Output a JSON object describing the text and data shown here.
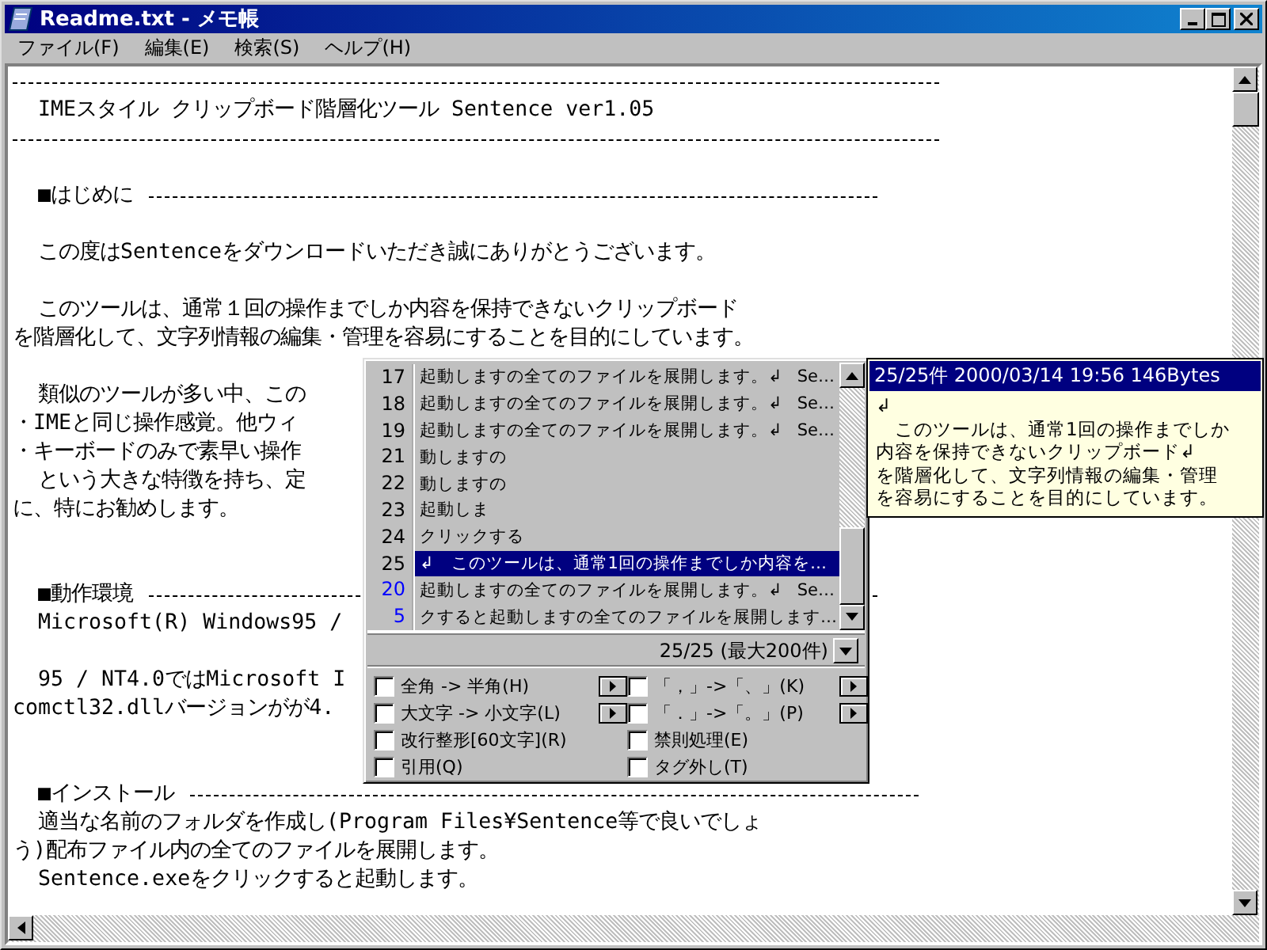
{
  "window": {
    "title": "Readme.txt - メモ帳"
  },
  "menu": [
    "ファイル(F)",
    "編集(E)",
    "検索(S)",
    "ヘルプ(H)"
  ],
  "document": [
    {
      "kind": "rule"
    },
    {
      "kind": "text",
      "text": "  IMEスタイル クリップボード階層化ツール Sentence ver1.05"
    },
    {
      "kind": "rule"
    },
    {
      "kind": "blank"
    },
    {
      "kind": "heading",
      "text": "  ■はじめに"
    },
    {
      "kind": "blank"
    },
    {
      "kind": "text",
      "text": "  この度はSentenceをダウンロードいただき誠にありがとうございます。"
    },
    {
      "kind": "blank"
    },
    {
      "kind": "text",
      "text": "  このツールは、通常１回の操作までしか内容を保持できないクリップボード"
    },
    {
      "kind": "text",
      "text": "を階層化して、文字列情報の編集・管理を容易にすることを目的にしています。"
    },
    {
      "kind": "blank"
    },
    {
      "kind": "text",
      "text": "  類似のツールが多い中、この"
    },
    {
      "kind": "text",
      "text": "・IMEと同じ操作感覚。他ウィ"
    },
    {
      "kind": "text",
      "text": "・キーボードのみで素早い操作"
    },
    {
      "kind": "text",
      "text": "  という大きな特徴を持ち、定"
    },
    {
      "kind": "text",
      "text": "に、特にお勧めします。"
    },
    {
      "kind": "blank"
    },
    {
      "kind": "blank"
    },
    {
      "kind": "heading",
      "text": "  ■動作環境"
    },
    {
      "kind": "text",
      "text": "  Microsoft(R) Windows95 / "
    },
    {
      "kind": "blank"
    },
    {
      "kind": "text",
      "text": "  95 / NT4.0ではMicrosoft I"
    },
    {
      "kind": "text",
      "text": "comctl32.dllバージョンがが4."
    },
    {
      "kind": "blank"
    },
    {
      "kind": "blank"
    },
    {
      "kind": "heading",
      "text": "  ■インストール"
    },
    {
      "kind": "text",
      "text": "  適当な名前のフォルダを作成し(Program Files¥Sentence等で良いでしょ"
    },
    {
      "kind": "text",
      "text": "う)配布ファイル内の全てのファイルを展開します。"
    },
    {
      "kind": "text",
      "text": "  Sentence.exeをクリックすると起動します。"
    }
  ],
  "clip_list": {
    "rows": [
      {
        "number": "17",
        "color": "#000000",
        "text": "起動しますの全てのファイルを展開します。↲",
        "extra": "Se…",
        "selected": false
      },
      {
        "number": "18",
        "color": "#000000",
        "text": "起動しますの全てのファイルを展開します。↲",
        "extra": "Se…",
        "selected": false
      },
      {
        "number": "19",
        "color": "#000000",
        "text": "起動しますの全てのファイルを展開します。↲",
        "extra": "Se…",
        "selected": false
      },
      {
        "number": "21",
        "color": "#000000",
        "text": "動しますの",
        "selected": false
      },
      {
        "number": "22",
        "color": "#000000",
        "text": "動しますの",
        "selected": false
      },
      {
        "number": "23",
        "color": "#000000",
        "text": "起動しま",
        "selected": false
      },
      {
        "number": "24",
        "color": "#000000",
        "text": "クリックする",
        "selected": false
      },
      {
        "number": "25",
        "color": "#000000",
        "text": "↲　このツールは、通常1回の操作までしか内容を…",
        "selected": true
      },
      {
        "number": "20",
        "color": "#0000ff",
        "text": "起動しますの全てのファイルを展開します。↲",
        "extra": "Se…",
        "selected": false
      },
      {
        "number": "5",
        "color": "#0000ff",
        "text": "クすると起動しますの全てのファイルを展開します…",
        "selected": false
      }
    ],
    "status": "25/25 (最大200件)",
    "options": [
      {
        "label": "全角 -> 半角(H)",
        "checked": false,
        "submenu": true
      },
      {
        "label": "「，」->「、」(K)",
        "checked": false,
        "submenu": true
      },
      {
        "label": "大文字 -> 小文字(L)",
        "checked": false,
        "submenu": true
      },
      {
        "label": "「．」->「。」(P)",
        "checked": false,
        "submenu": true
      },
      {
        "label": "改行整形[60文字](R)",
        "checked": false,
        "submenu": false
      },
      {
        "label": "禁則処理(E)",
        "checked": false,
        "submenu": false
      },
      {
        "label": "引用(Q)",
        "checked": false,
        "submenu": false
      },
      {
        "label": "タグ外し(T)",
        "checked": false,
        "submenu": false
      }
    ]
  },
  "tooltip": {
    "header": "25/25件 2000/03/14 19:56  146Bytes",
    "lines": [
      "↲",
      "　このツールは、通常1回の操作までしか",
      "内容を保持できないクリップボード↲",
      "を階層化して、文字列情報の編集・管理",
      "を容易にすることを目的にしています。"
    ]
  }
}
